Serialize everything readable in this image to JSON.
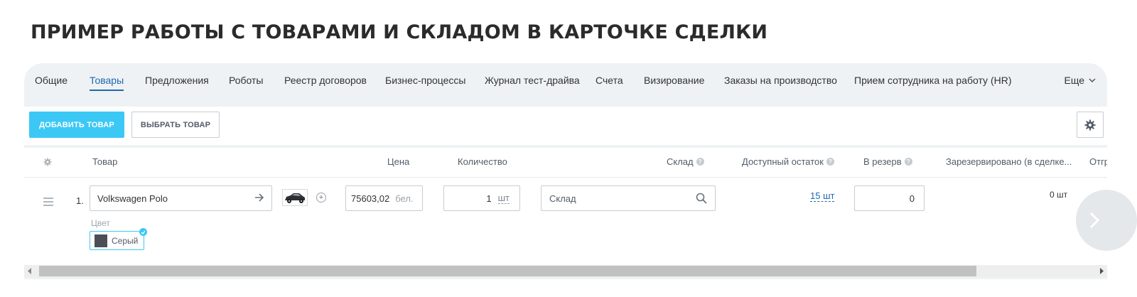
{
  "page": {
    "title": "ПРИМЕР РАБОТЫ С ТОВАРАМИ И СКЛАДОМ В КАРТОЧКЕ СДЕЛКИ"
  },
  "tabs": {
    "items": [
      "Общие",
      "Товары",
      "Предложения",
      "Роботы",
      "Реестр договоров",
      "Бизнес-процессы",
      "Журнал тест-драйва",
      "Счета",
      "Визирование",
      "Заказы на производство",
      "Прием сотрудника на работу (HR)"
    ],
    "active": "Товары",
    "more_label": "Еще"
  },
  "toolbar": {
    "add_label": "ДОБАВИТЬ ТОВАР",
    "select_label": "ВЫБРАТЬ ТОВАР"
  },
  "grid": {
    "columns": [
      "Товар",
      "Цена",
      "Количество",
      "Склад",
      "Доступный остаток",
      "В резерв",
      "Зарезервировано (в сделке...",
      "Отгр"
    ],
    "row": {
      "number": "1.",
      "product": "Volkswagen Polo",
      "price": "75603,02",
      "currency": "бел.",
      "quantity": "1",
      "unit": "шт",
      "store_placeholder": "Склад",
      "available": "15 шт",
      "reserve": "0",
      "reserved": "0 шт",
      "color_label": "Цвет",
      "color_value": "Серый"
    }
  },
  "colors": {
    "accent": "#3bc8f5",
    "link": "#2067b0",
    "panel": "#eef2f4"
  }
}
